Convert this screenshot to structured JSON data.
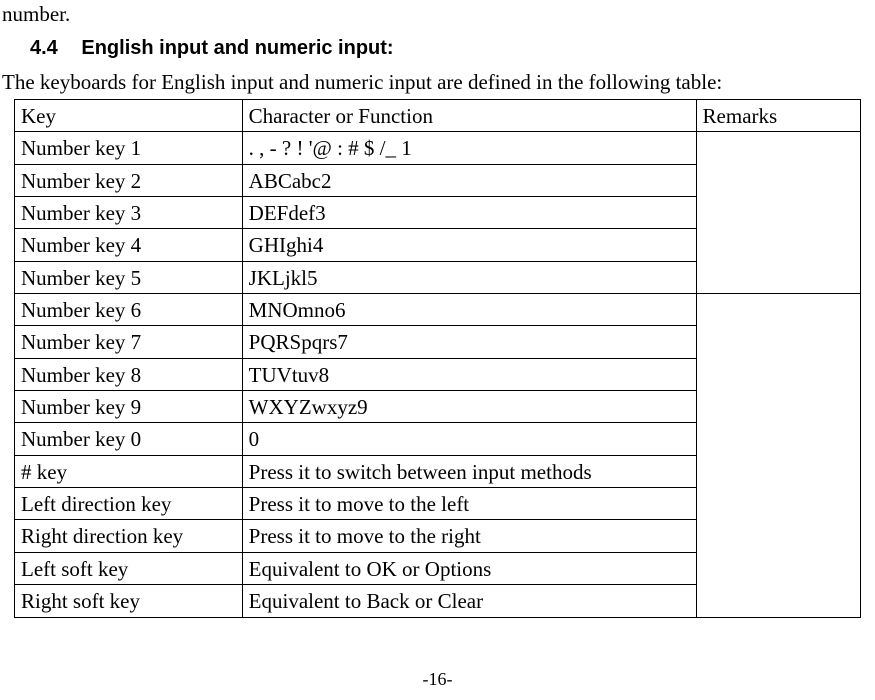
{
  "top_fragment": "number.",
  "section": {
    "number": "4.4",
    "title": "English input and numeric input:"
  },
  "intro": "The keyboards for English input and numeric input are defined in the following table:",
  "table": {
    "headers": {
      "key": "Key",
      "char": "Character or Function",
      "remarks": "Remarks"
    },
    "rows": [
      {
        "key": "Number key 1",
        "char": ". , - ? ! '@ : # $ /_ 1"
      },
      {
        "key": "Number key 2",
        "char": "ABCabc2"
      },
      {
        "key": "Number key 3",
        "char": "DEFdef3"
      },
      {
        "key": "Number key 4",
        "char": "GHIghi4"
      },
      {
        "key": "Number key 5",
        "char": "JKLjkl5"
      },
      {
        "key": "Number key 6",
        "char": "MNOmno6"
      },
      {
        "key": "Number key 7",
        "char": "PQRSpqrs7"
      },
      {
        "key": "Number key 8",
        "char": "TUVtuv8"
      },
      {
        "key": "Number key 9",
        "char": "WXYZwxyz9"
      },
      {
        "key": "Number key 0",
        "char": "0"
      },
      {
        "key": "# key",
        "char": "Press it to switch between input methods"
      },
      {
        "key": "Left direction key",
        "char": "Press it to move to the left"
      },
      {
        "key": "Right direction key",
        "char": "Press it to move to the right"
      },
      {
        "key": "Left soft key",
        "char": "Equivalent to OK or Options"
      },
      {
        "key": "Right soft key",
        "char": "Equivalent to Back or Clear"
      }
    ],
    "remarks_group1": "",
    "remarks_group2": ""
  },
  "page_number": "-16-"
}
